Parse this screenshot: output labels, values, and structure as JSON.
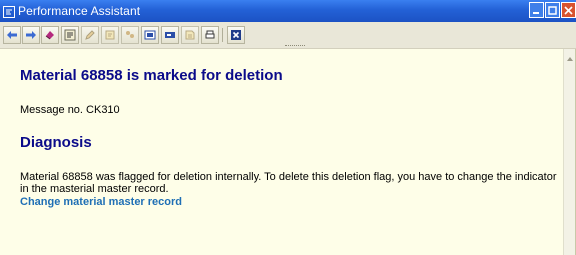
{
  "window": {
    "title": "Performance Assistant",
    "controls": [
      "minimize-icon",
      "maximize-icon",
      "close-icon"
    ],
    "accent": "#2361d6",
    "background": "#fefee8"
  },
  "toolbar": {
    "buttons": [
      {
        "name": "back-icon"
      },
      {
        "name": "forward-icon"
      },
      {
        "name": "eraser-icon"
      },
      {
        "name": "technical-info-icon"
      },
      {
        "name": "edit-icon"
      },
      {
        "name": "note-icon"
      },
      {
        "name": "group-icon"
      },
      {
        "name": "display-icon"
      },
      {
        "name": "tag-icon"
      },
      {
        "name": "doc-icon"
      },
      {
        "name": "print-icon"
      },
      {
        "name": "exit-icon"
      }
    ]
  },
  "message": {
    "title": "Material 68858 is marked for deletion",
    "number": "Message no. CK310",
    "title_color": "#0b0b8a"
  },
  "diagnosis": {
    "heading": "Diagnosis",
    "text": "Material 68858 was flagged for deletion internally.  To delete this deletion flag, you have to change the indicator in the masterial master record.",
    "link": "Change material master record",
    "link_color": "#1f6fb5"
  }
}
